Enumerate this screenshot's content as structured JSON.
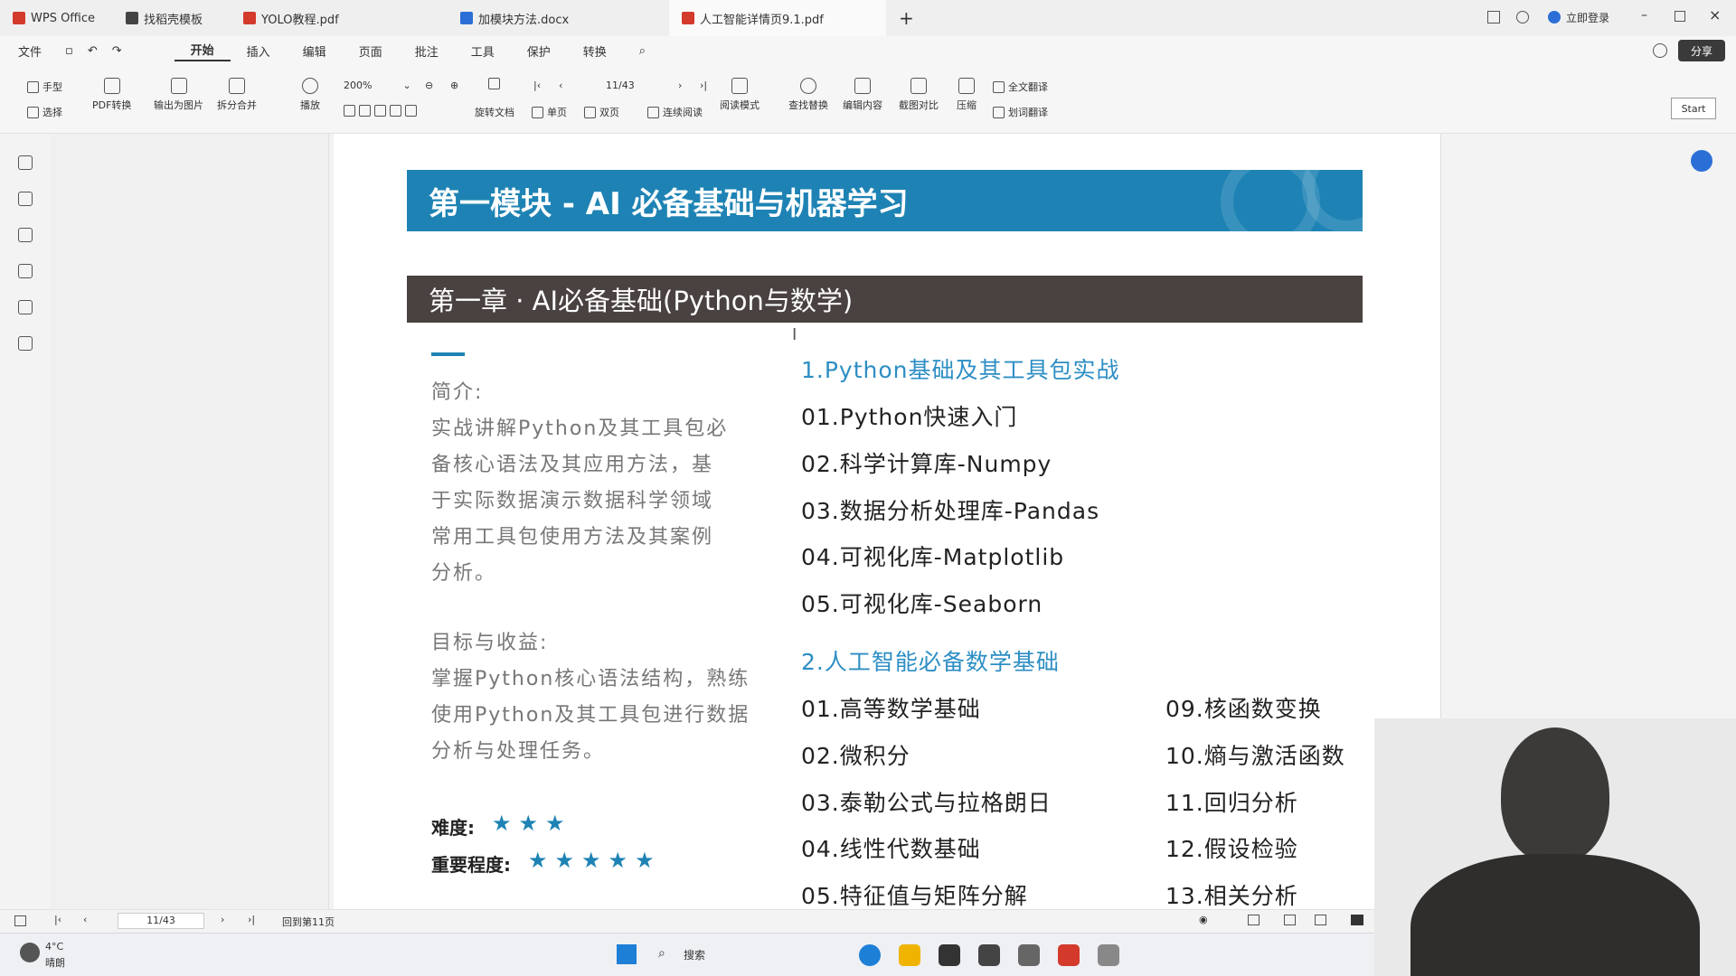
{
  "tabs": [
    {
      "label": "WPS Office",
      "color": "#d33a2c"
    },
    {
      "label": "找稻壳模板",
      "color": "#444444"
    },
    {
      "label": "YOLO教程.pdf",
      "color": "#d33a2c"
    },
    {
      "label": "加模块方法.docx",
      "color": "#2b6fd6"
    },
    {
      "label": "人工智能详情页9.1.pdf",
      "color": "#d33a2c"
    }
  ],
  "titlebar_right": {
    "login": "立即登录",
    "share": "分享"
  },
  "menu": [
    "文件",
    "开始",
    "插入",
    "编辑",
    "页面",
    "批注",
    "工具",
    "保护",
    "转换"
  ],
  "menu_active": "开始",
  "ribbon": {
    "hand": "手型",
    "select": "选择",
    "pdf_convert": "PDF转换",
    "export_img": "输出为图片",
    "split_merge": "拆分合并",
    "play": "播放",
    "zoom": "200%",
    "page_indicator": "11/43",
    "rotate": "旋转文档",
    "single": "单页",
    "double": "双页",
    "continuous": "连续阅读",
    "read_mode": "阅读模式",
    "find_replace": "查找替换",
    "edit_content": "编辑内容",
    "screenshot_compare": "截图对比",
    "compress": "压缩",
    "full_translate": "全文翻译",
    "translate_select": "划词翻译",
    "start_button": "Start"
  },
  "document": {
    "module_title": "第一模块 - AI 必备基础与机器学习",
    "chapter_title": "第一章 · AI必备基础(Python与数学)",
    "intro_label": "简介:",
    "intro_lines": [
      "实战讲解Python及其工具包必",
      "备核心语法及其应用方法，基",
      "于实际数据演示数据科学领域",
      "常用工具包使用方法及其案例",
      "分析。"
    ],
    "goal_label": "目标与收益:",
    "goal_lines": [
      "掌握Python核心语法结构，熟练",
      "使用Python及其工具包进行数据",
      "分析与处理任务。"
    ],
    "difficulty_label": "难度:",
    "difficulty_stars": "★★★",
    "difficulty_rating": 3,
    "importance_label": "重要程度:",
    "importance_stars": "★★★★★",
    "importance_rating": 5,
    "section1_title": "1.Python基础及其工具包实战",
    "section1_items": [
      "01.Python快速入门",
      "02.科学计算库-Numpy",
      "03.数据分析处理库-Pandas",
      "04.可视化库-Matplotlib",
      "05.可视化库-Seaborn"
    ],
    "section2_title": "2.人工智能必备数学基础",
    "section2_left": [
      "01.高等数学基础",
      "02.微积分",
      "03.泰勒公式与拉格朗日",
      "04.线性代数基础",
      "05.特征值与矩阵分解"
    ],
    "section2_right": [
      "09.核函数变换",
      "10.熵与激活函数",
      "11.回归分析",
      "12.假设检验",
      "13.相关分析"
    ]
  },
  "statusbar": {
    "page": "11/43",
    "goto": "回到第11页"
  },
  "taskbar": {
    "weather_temp": "4°C",
    "weather_desc": "晴朗",
    "search": "搜索"
  },
  "colors": {
    "module_banner": "#1e83b4",
    "chapter_banner": "#4a4141",
    "section_title": "#2d8ec4",
    "stars": "#1e83b4"
  }
}
